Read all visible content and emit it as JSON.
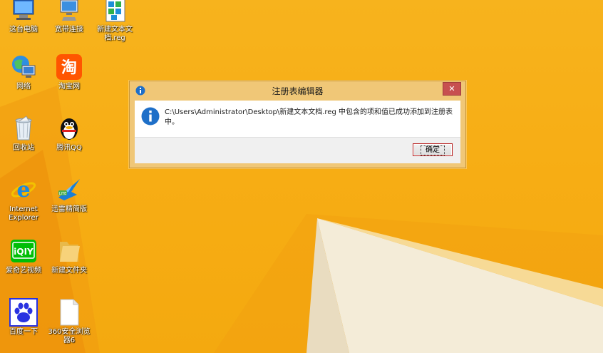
{
  "desktop": {
    "icons": [
      {
        "label": "这台电脑",
        "icon": "computer-icon"
      },
      {
        "label": "宽带连接",
        "icon": "network-connection-icon"
      },
      {
        "label": "新建文本文档.reg",
        "icon": "registry-file-icon"
      },
      {
        "label": "网络",
        "icon": "network-globe-icon"
      },
      {
        "label": "淘宝网",
        "icon": "taobao-icon"
      },
      {
        "label": "回收站",
        "icon": "recycle-bin-icon"
      },
      {
        "label": "腾讯QQ",
        "icon": "qq-penguin-icon"
      },
      {
        "label": "Internet\nExplorer",
        "icon": "internet-explorer-icon"
      },
      {
        "label": "迅雷精简版",
        "icon": "xunlei-bird-icon"
      },
      {
        "label": "爱奇艺视频",
        "icon": "iqiyi-icon"
      },
      {
        "label": "新建文件夹",
        "icon": "folder-icon"
      },
      {
        "label": "百度一下",
        "icon": "baidu-paw-icon"
      },
      {
        "label": "360安全浏览\n器6",
        "icon": "blank-document-icon"
      }
    ]
  },
  "dialog": {
    "title": "注册表编辑器",
    "message": "C:\\Users\\Administrator\\Desktop\\新建文本文档.reg 中包含的项和值已成功添加到注册表中。",
    "ok_label": "确定",
    "close_glyph": "✕"
  },
  "colors": {
    "wallpaper": "#f7b31d",
    "dialog_frame": "#f0c777",
    "close_button": "#c75050",
    "info_blue": "#1e6fc8"
  }
}
